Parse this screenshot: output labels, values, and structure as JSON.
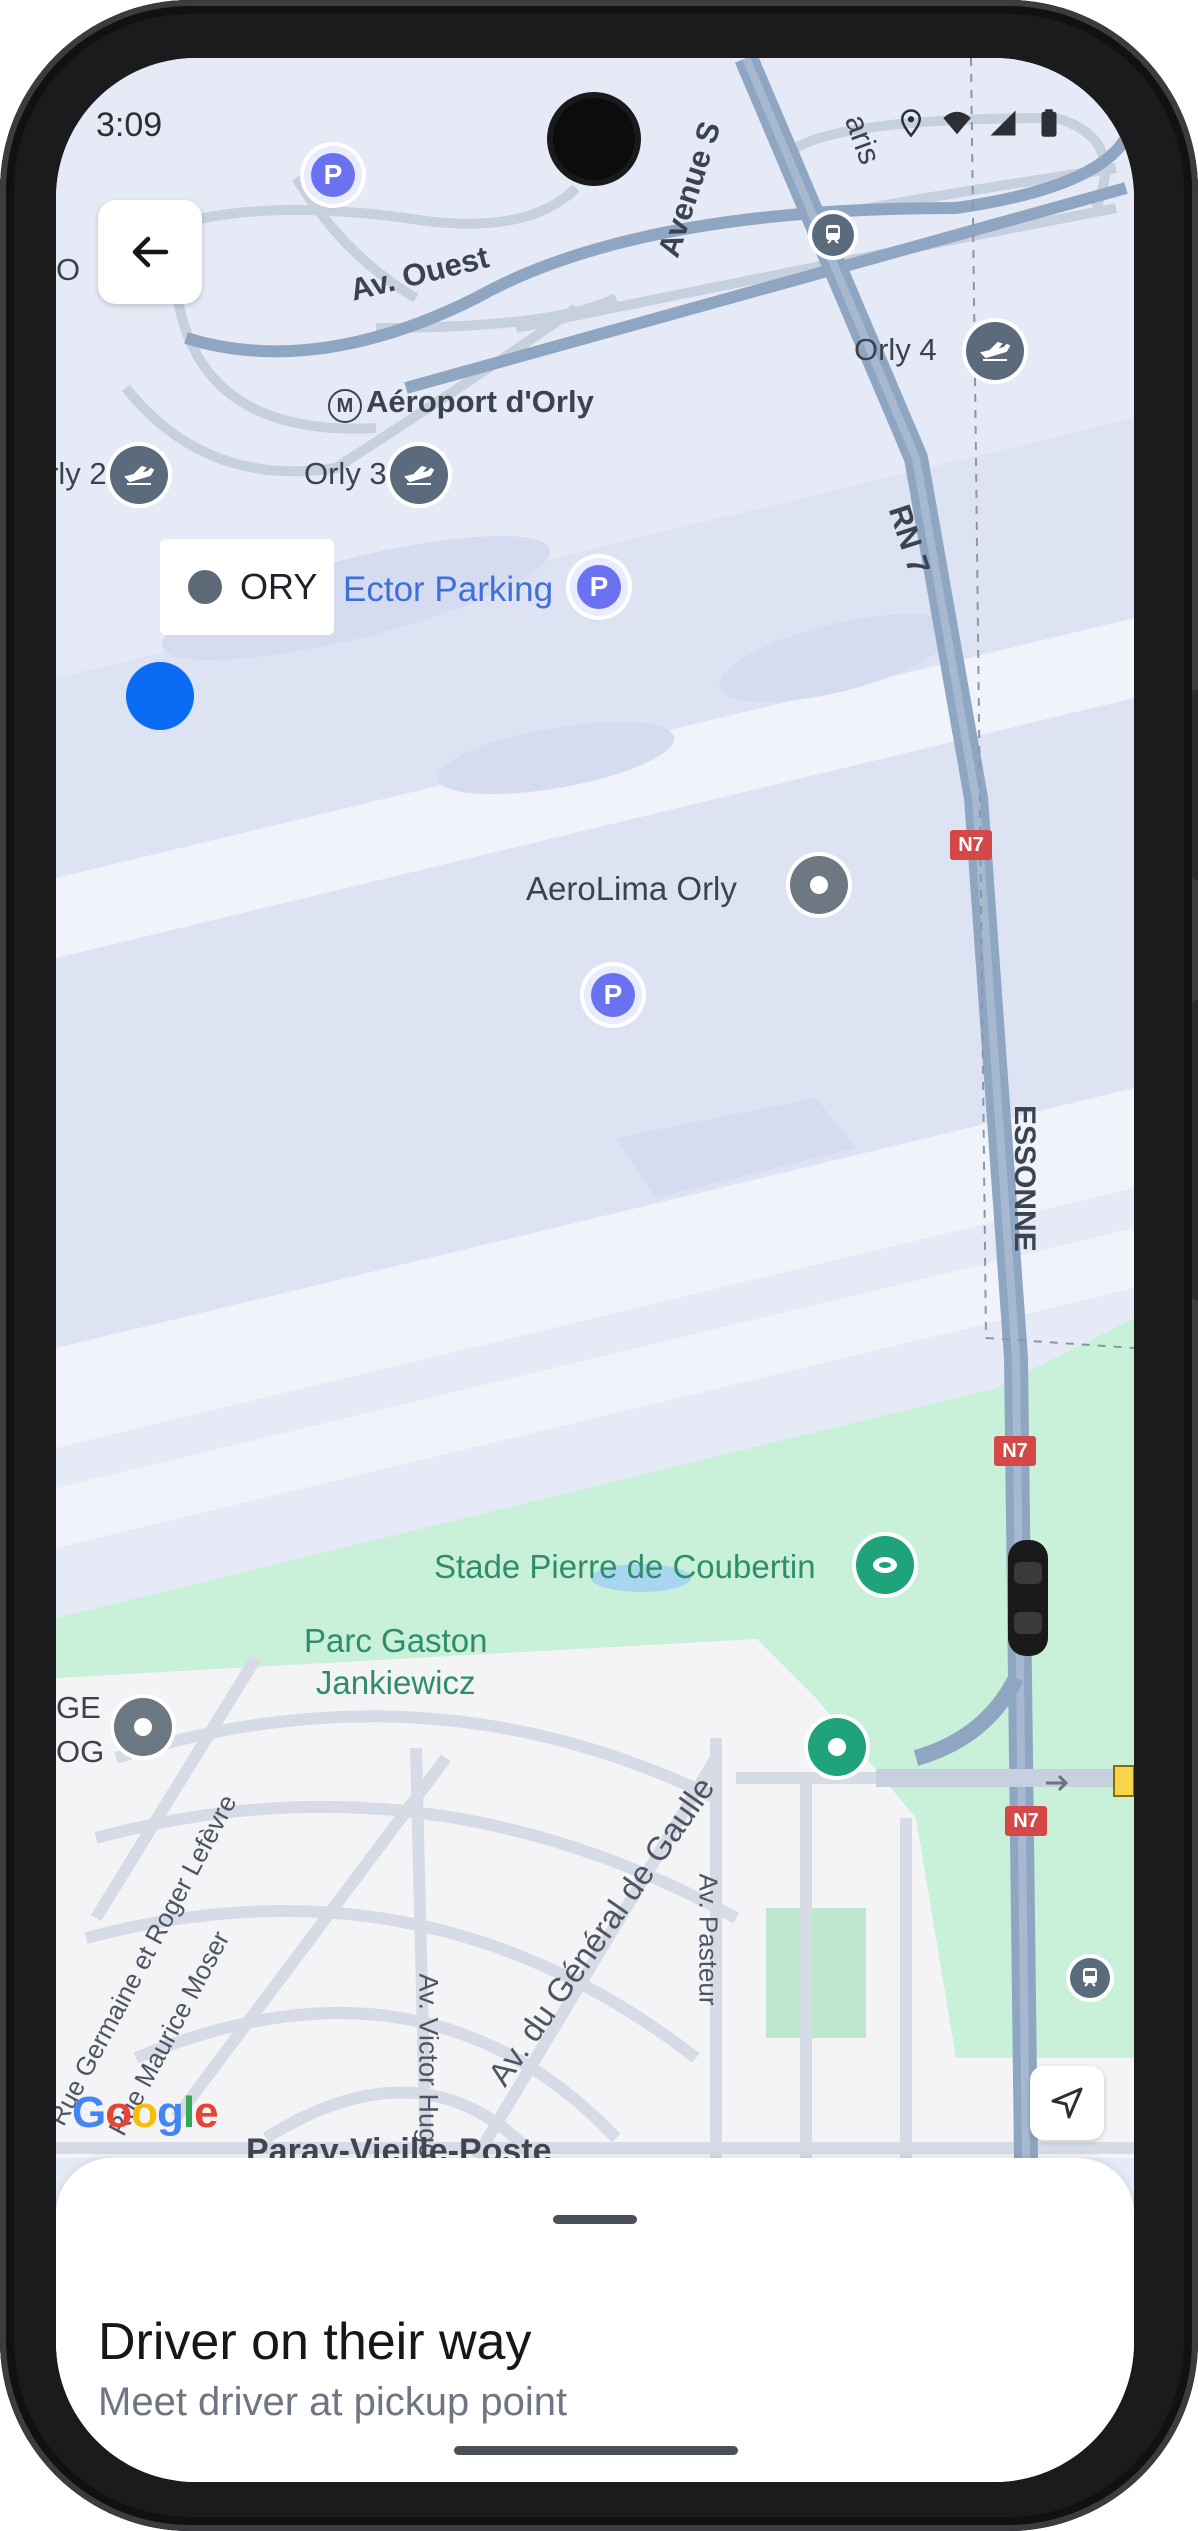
{
  "status_bar": {
    "time": "3:09"
  },
  "header": {
    "back_icon": "arrow-left-icon"
  },
  "pickup_chip": {
    "label": "ORY"
  },
  "map": {
    "labels": {
      "av_ouest": "Av. Ouest",
      "avenue_s": "Avenue S",
      "paris": "aris",
      "aeroport": "Aéroport d'Orly",
      "orly2": "rly 2",
      "orly3": "Orly 3",
      "orly4": "Orly 4",
      "rn7": "RN 7",
      "o_edge": "O",
      "ector_parking": "Ector Parking",
      "aerolima": "AeroLima Orly",
      "essonne": "ESSONNE",
      "n7": "N7",
      "stade": "Stade Pierre de Coubertin",
      "parc_line1": "Parc Gaston",
      "parc_line2": "Jankiewicz",
      "ge": "GE",
      "og": "OG",
      "av_victor_hugo": "Av. Victor Hugo",
      "av_general": "Av. du Général de Gaulle",
      "av_pasteur": "Av. Pasteur",
      "rue_germaine": "Rue Germaine et Roger Lefèvre",
      "rue_maurice": "Rue Maurice Moser",
      "paray": "Paray-Vieille-Poste"
    },
    "google_logo": "Google"
  },
  "bottom_sheet": {
    "title": "Driver on their way",
    "subtitle": "Meet driver at pickup point"
  },
  "colors": {
    "map_bg": "#eaeef8",
    "highway": "#8fa6c2",
    "user_dot": "#0a6cf5",
    "park_green": "#c9f0d8"
  }
}
